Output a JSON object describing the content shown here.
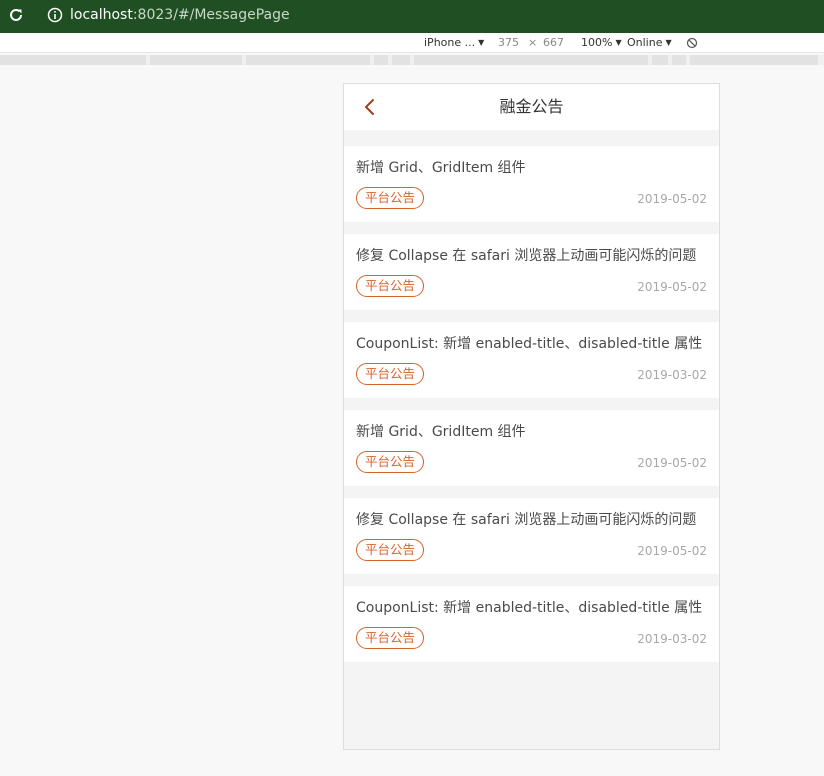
{
  "browser": {
    "url_host": "localhost",
    "url_path": ":8023/#/MessagePage",
    "device": "iPhone ...",
    "width": "375",
    "times": "×",
    "height": "667",
    "zoom": "100%",
    "network": "Online"
  },
  "nav": {
    "title": "融金公告",
    "back_icon": "chevron-left-icon"
  },
  "colors": {
    "accent": "#d9622b",
    "browser_bar": "#1f4f22"
  },
  "notices": [
    {
      "title": "新增 Grid、GridItem 组件",
      "tag": "平台公告",
      "date": "2019-05-02"
    },
    {
      "title": "修复 Collapse 在 safari 浏览器上动画可能闪烁的问题",
      "tag": "平台公告",
      "date": "2019-05-02"
    },
    {
      "title": "CouponList: 新增 enabled-title、disabled-title 属性",
      "tag": "平台公告",
      "date": "2019-03-02"
    },
    {
      "title": "新增 Grid、GridItem 组件",
      "tag": "平台公告",
      "date": "2019-05-02"
    },
    {
      "title": "修复 Collapse 在 safari 浏览器上动画可能闪烁的问题",
      "tag": "平台公告",
      "date": "2019-05-02"
    },
    {
      "title": "CouponList: 新增 enabled-title、disabled-title 属性",
      "tag": "平台公告",
      "date": "2019-03-02"
    }
  ]
}
